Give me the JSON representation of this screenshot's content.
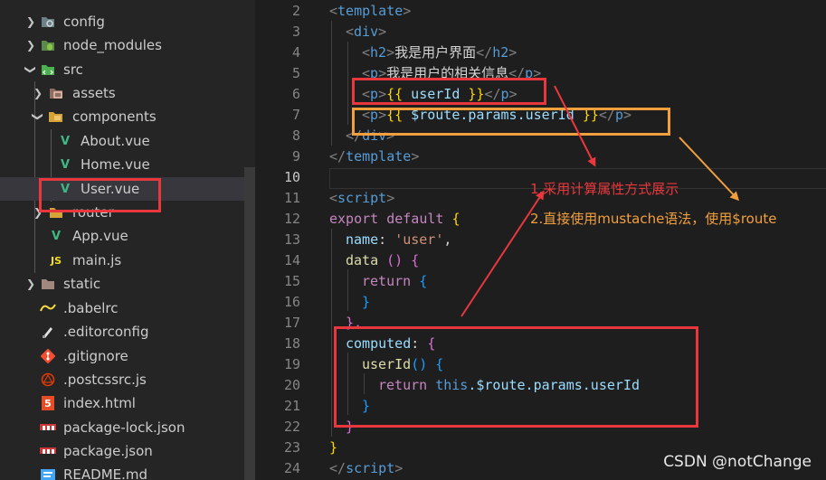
{
  "explorer": {
    "items": [
      {
        "label": "config",
        "icon": "config-folder-icon"
      },
      {
        "label": "node_modules",
        "icon": "node-modules-folder-icon"
      },
      {
        "label": "src",
        "icon": "src-folder-icon"
      },
      {
        "label": "assets",
        "icon": "assets-folder-icon"
      },
      {
        "label": "components",
        "icon": "components-folder-icon"
      },
      {
        "label": "About.vue",
        "icon": "vue-file-icon"
      },
      {
        "label": "Home.vue",
        "icon": "vue-file-icon"
      },
      {
        "label": "User.vue",
        "icon": "vue-file-icon"
      },
      {
        "label": "router",
        "icon": "router-folder-icon"
      },
      {
        "label": "App.vue",
        "icon": "vue-file-icon"
      },
      {
        "label": "main.js",
        "icon": "js-file-icon"
      },
      {
        "label": "static",
        "icon": "static-folder-icon"
      },
      {
        "label": ".babelrc",
        "icon": "babel-file-icon"
      },
      {
        "label": ".editorconfig",
        "icon": "editorconfig-file-icon"
      },
      {
        "label": ".gitignore",
        "icon": "git-file-icon"
      },
      {
        "label": ".postcssrc.js",
        "icon": "postcss-file-icon"
      },
      {
        "label": "index.html",
        "icon": "html-file-icon"
      },
      {
        "label": "package-lock.json",
        "icon": "npm-file-icon"
      },
      {
        "label": "package.json",
        "icon": "npm-file-icon"
      },
      {
        "label": "README.md",
        "icon": "readme-file-icon"
      }
    ],
    "icon_glyphs": {
      "js": "JS",
      "html": "5",
      "vue": "V"
    }
  },
  "editor": {
    "line_numbers": [
      "2",
      "3",
      "4",
      "5",
      "6",
      "7",
      "8",
      "9",
      "10",
      "11",
      "12",
      "13",
      "14",
      "15",
      "16",
      "17",
      "18",
      "19",
      "20",
      "21",
      "22",
      "23",
      "24"
    ],
    "active_line": "10",
    "code": {
      "l2_tag": "template",
      "l3_tag": "div",
      "l4_tag": "h2",
      "l4_text": "我是用户界面",
      "l5_tag": "p",
      "l5_text": "我是用户的相关信息",
      "l6_tag": "p",
      "l6_open": "{{",
      "l6_expr": " userId ",
      "l6_close": "}}",
      "l7_tag": "p",
      "l7_open": "{{",
      "l7_expr": " $route.params.userId ",
      "l7_close": "}}",
      "l8_tag": "div",
      "l9_tag": "template",
      "l11_tag": "script",
      "l12_export": "export",
      "l12_default": "default",
      "l12_brace": "{",
      "l13_key": "name",
      "l13_value": "'user'",
      "l14_fn": "data",
      "l14_parens": "()",
      "l14_brace": "{",
      "l15_kw": "return",
      "l15_brace": "{",
      "l16_brace": "}",
      "l17_brace": "},",
      "l18_key": "computed",
      "l18_brace": "{",
      "l19_fn": "userId",
      "l19_parens": "()",
      "l19_brace": "{",
      "l20_kw": "return",
      "l20_this": "this",
      "l20_rest": ".$route.params.userId",
      "l21_brace": "}",
      "l22_brace": "}",
      "l23_brace": "}",
      "l24_tag": "script"
    }
  },
  "annotations": {
    "note1": "1.采用计算属性方式展示",
    "note2": "2.直接使用mustache语法，使用$route",
    "red": "#e8383d",
    "orange": "#f2a03d"
  },
  "watermark": "CSDN @notChange"
}
